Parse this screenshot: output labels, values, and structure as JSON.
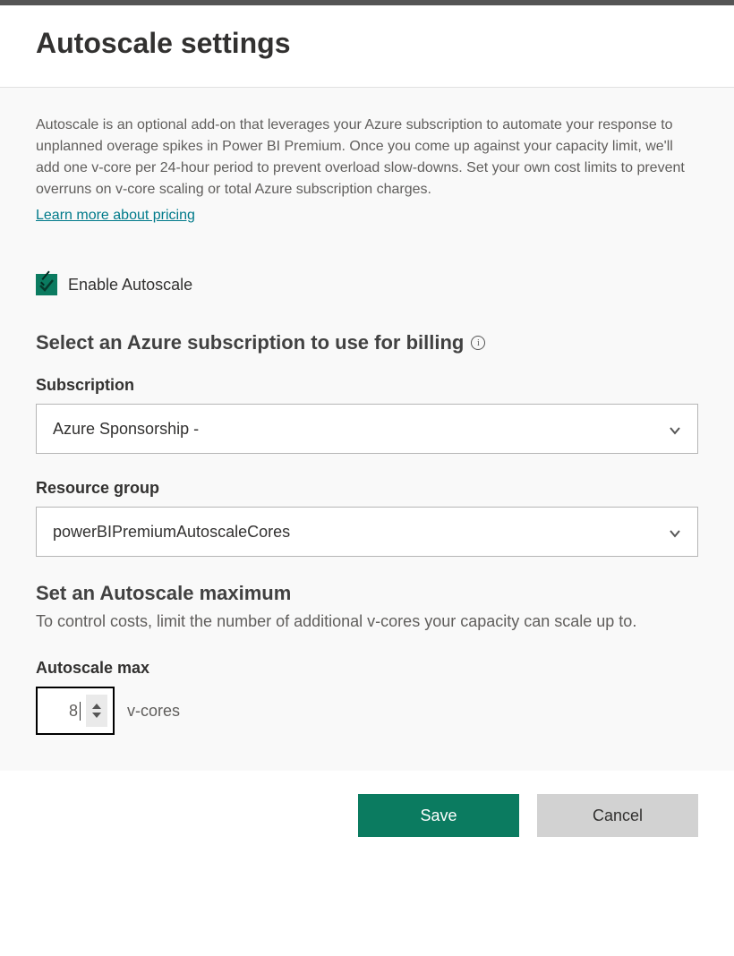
{
  "title": "Autoscale settings",
  "description": "Autoscale is an optional add-on that leverages your Azure subscription to automate your response to unplanned overage spikes in Power BI Premium. Once you come up against your capacity limit, we'll add one v-core per 24-hour period to prevent overload slow-downs. Set your own cost limits to prevent overruns on v-core scaling or total Azure subscription charges.",
  "pricing_link": "Learn more about pricing",
  "enable_label": "Enable Autoscale",
  "enable_checked": true,
  "billing_heading": "Select an Azure subscription to use for billing",
  "subscription": {
    "label": "Subscription",
    "value": "Azure Sponsorship -"
  },
  "resource_group": {
    "label": "Resource group",
    "value": "powerBIPremiumAutoscaleCores"
  },
  "max_section": {
    "heading": "Set an Autoscale maximum",
    "description": "To control costs, limit the number of additional v-cores your capacity can scale up to.",
    "label": "Autoscale max",
    "value": "8",
    "suffix": "v-cores"
  },
  "buttons": {
    "save": "Save",
    "cancel": "Cancel"
  }
}
